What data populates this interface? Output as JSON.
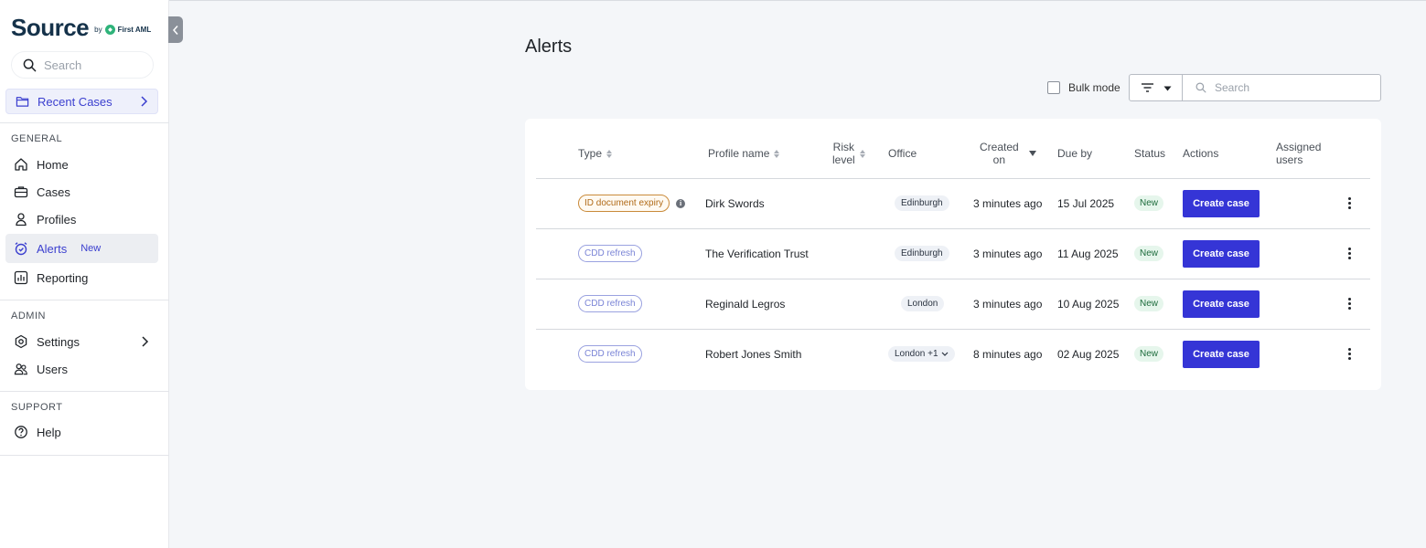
{
  "brand": {
    "name": "Source",
    "by": "by",
    "partner": "First AML"
  },
  "sidebar": {
    "search_placeholder": "Search",
    "recent_cases": "Recent Cases",
    "sections": {
      "general": "GENERAL",
      "admin": "ADMIN",
      "support": "SUPPORT"
    },
    "items": {
      "home": "Home",
      "cases": "Cases",
      "profiles": "Profiles",
      "alerts": "Alerts",
      "alerts_badge": "New",
      "reporting": "Reporting",
      "settings": "Settings",
      "users": "Users",
      "help": "Help"
    }
  },
  "main": {
    "title": "Alerts",
    "bulk_mode": "Bulk mode",
    "search_placeholder": "Search",
    "columns": {
      "type": "Type",
      "profile_name": "Profile name",
      "risk_level_1": "Risk",
      "risk_level_2": "level",
      "office": "Office",
      "created_on_1": "Created",
      "created_on_2": "on",
      "due_by": "Due by",
      "status": "Status",
      "actions": "Actions",
      "assigned_1": "Assigned",
      "assigned_2": "users"
    },
    "rows": [
      {
        "type": "ID document expiry",
        "profile": "Dirk Swords",
        "office": "Edinburgh",
        "created": "3 minutes ago",
        "due": "15 Jul 2025",
        "status": "New",
        "action": "Create case"
      },
      {
        "type": "CDD refresh",
        "profile": "The Verification Trust",
        "office": "Edinburgh",
        "created": "3 minutes ago",
        "due": "11 Aug 2025",
        "status": "New",
        "action": "Create case"
      },
      {
        "type": "CDD refresh",
        "profile": "Reginald Legros",
        "office": "London",
        "created": "3 minutes ago",
        "due": "10 Aug 2025",
        "status": "New",
        "action": "Create case"
      },
      {
        "type": "CDD refresh",
        "profile": "Robert Jones Smith",
        "office": "London +1",
        "created": "8 minutes ago",
        "due": "02 Aug 2025",
        "status": "New",
        "action": "Create case"
      }
    ]
  },
  "colors": {
    "accent": "#3535d6",
    "brand": "#15324a",
    "expiry_tag": "#b06a17",
    "cdd_tag": "#7a84d6",
    "status_new": "#1d6b3c"
  },
  "info_glyph": "i"
}
